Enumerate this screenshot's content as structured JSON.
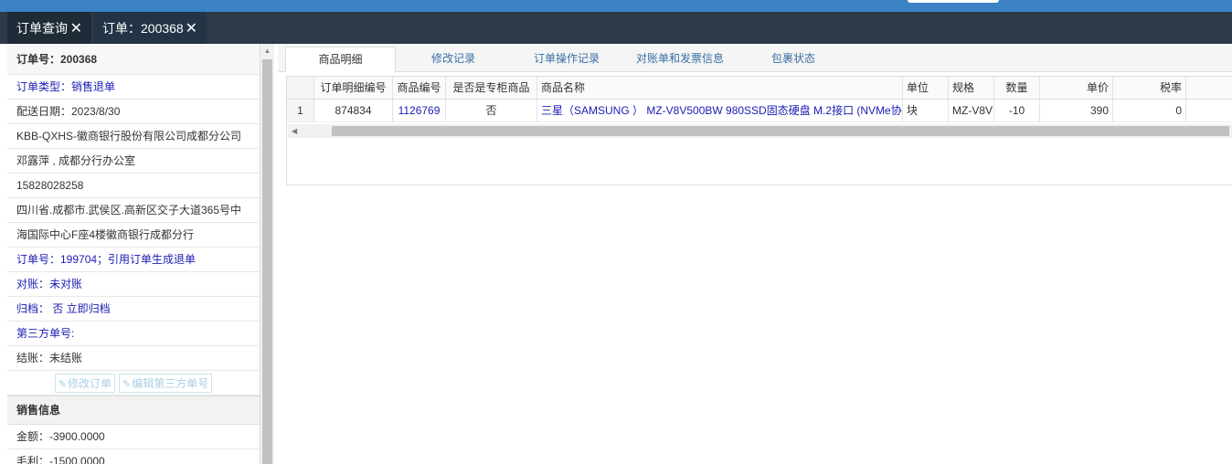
{
  "tabs": [
    {
      "label": "订单查询"
    },
    {
      "label": "订单：200368"
    }
  ],
  "left": {
    "rows": [
      {
        "text": "订单号：200368",
        "style": "head"
      },
      {
        "text": "订单类型：销售退单",
        "style": "blue"
      },
      {
        "text": "配送日期：2023/8/30",
        "style": "plain"
      },
      {
        "text": "KBB-QXHS-徽商银行股份有限公司成都分公司",
        "style": "plain"
      },
      {
        "text": "邓露萍 , 成都分行办公室",
        "style": "plain"
      },
      {
        "text": "15828028258",
        "style": "plain"
      },
      {
        "text": "四川省.成都市.武侯区.高新区交子大道365号中",
        "style": "plain"
      },
      {
        "text": "海国际中心F座4楼徽商银行成都分行",
        "style": "plain"
      },
      {
        "text": "订单号：199704；引用订单生成退单",
        "style": "blue"
      },
      {
        "text": "对账：未对账",
        "style": "blue"
      },
      {
        "text": "归档：  否 立即归档",
        "style": "blue"
      },
      {
        "text": "第三方单号:",
        "style": "blue"
      },
      {
        "text": "结账：未结账",
        "style": "plain"
      }
    ],
    "buttons": {
      "modify": "修改订单",
      "edit_third": "编辑第三方单号"
    },
    "sales_section": "销售信息",
    "sales_rows": [
      {
        "text": "金额：-3900.0000"
      },
      {
        "text": "毛利：-1500.0000"
      }
    ]
  },
  "subtabs": [
    {
      "label": "商品明细"
    },
    {
      "label": "修改记录"
    },
    {
      "label": "订单操作记录"
    },
    {
      "label": "对账单和发票信息"
    },
    {
      "label": "包裹状态"
    }
  ],
  "grid": {
    "headers": [
      "",
      "订单明细编号",
      "商品编号",
      "是否是专柜商品",
      "商品名称",
      "单位",
      "规格",
      "数量",
      "单价",
      "税率"
    ],
    "rows": [
      [
        "1",
        "874834",
        "1126769",
        "否",
        "三星（SAMSUNG ） MZ-V8V500BW 980SSD固态硬盘 M.2接口 (NVMe协",
        "块",
        "MZ-V8V",
        "-10",
        "390",
        "0"
      ]
    ]
  },
  "colors": {
    "top_strip": "#3a82c4",
    "tab_bar": "#2d3a47",
    "link_blue": "#1b1bb5"
  }
}
